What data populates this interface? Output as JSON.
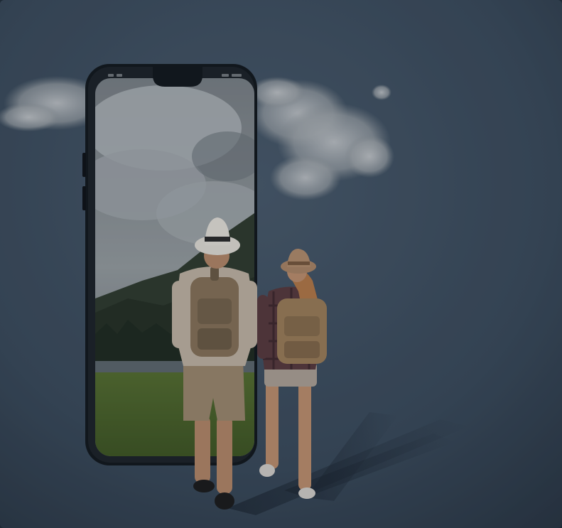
{
  "scene": {
    "description_colors": {
      "background": "#3d5063",
      "background_dark": "#24313e",
      "phone_frame": "#141a20",
      "sky": "#8f979c",
      "grass": "#4f6a2a",
      "mountain": "#2e3a2c",
      "shadow": "#1d2833"
    }
  },
  "phone": {
    "status_left": "",
    "status_right": ""
  }
}
